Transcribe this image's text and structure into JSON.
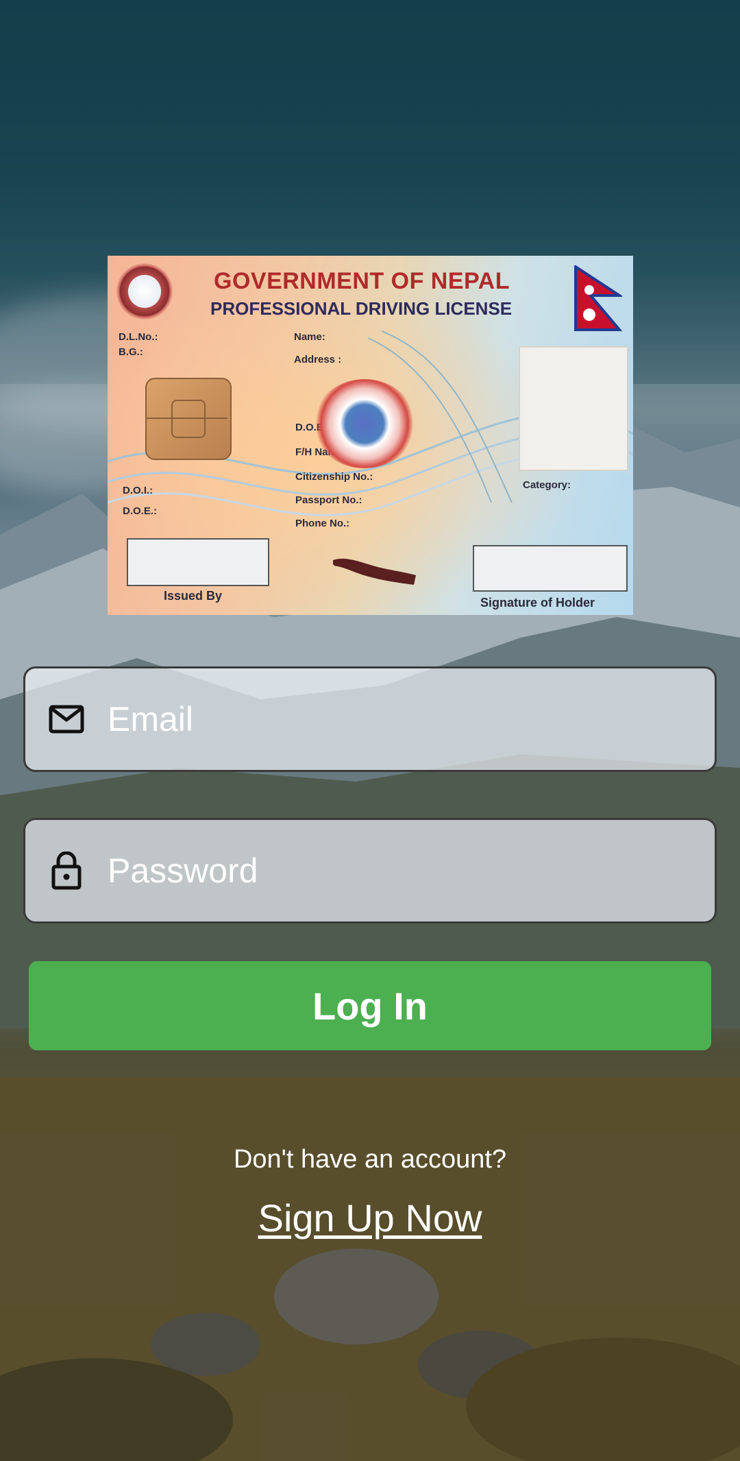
{
  "card_image": {
    "title": "GOVERNMENT OF NEPAL",
    "subtitle": "PROFESSIONAL DRIVING LICENSE",
    "labels": {
      "dl_no": "D.L.No.:",
      "bg": "B.G.:",
      "name": "Name:",
      "address": "Address :",
      "dob": "D.O.B.:",
      "fh_name": "F/H Name:",
      "citizenship": "Citizenship No.:",
      "passport": "Passport No.:",
      "phone": "Phone No.:",
      "doi": "D.O.I.:",
      "doe": "D.O.E.:",
      "category": "Category:",
      "issued_by": "Issued By",
      "signature": "Signature of Holder"
    }
  },
  "form": {
    "email": {
      "placeholder": "Email",
      "icon": "mail-icon"
    },
    "password": {
      "placeholder": "Password",
      "icon": "lock-open-icon"
    },
    "login_label": "Log In"
  },
  "footer": {
    "question": "Don't have an account?",
    "signup_label": "Sign Up Now"
  },
  "colors": {
    "login_button": "#4caf50",
    "text": "#ffffff"
  }
}
